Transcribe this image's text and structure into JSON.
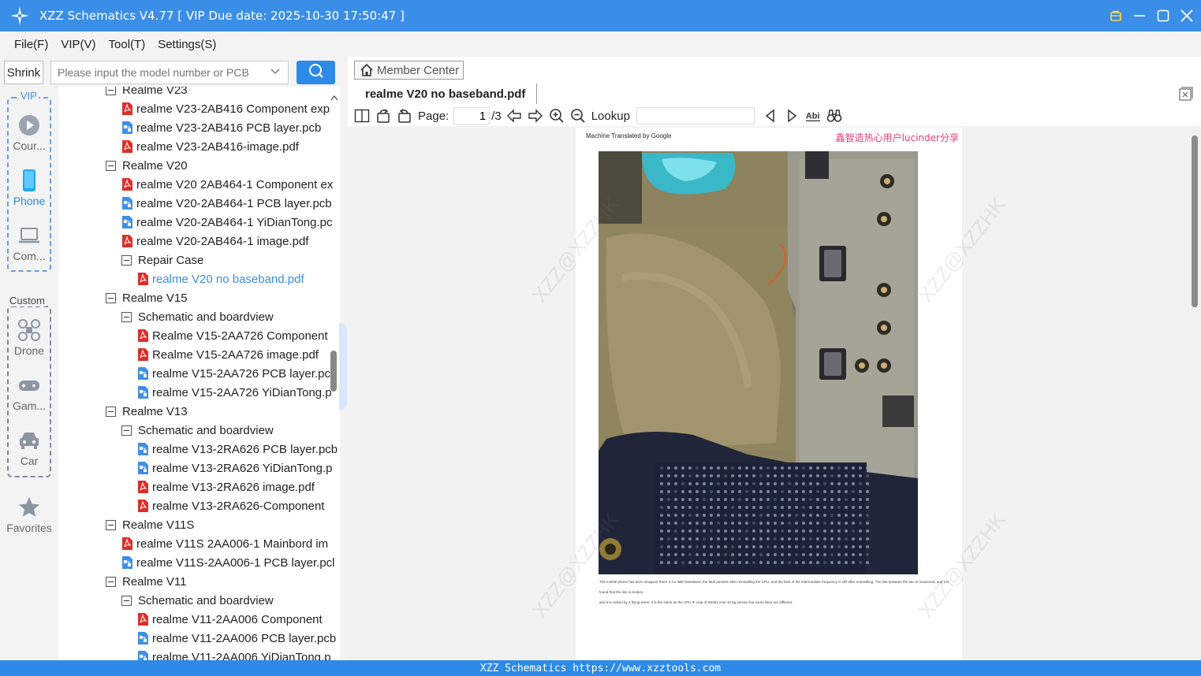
{
  "window": {
    "title": "XZZ Schematics V4.77 [ VIP Due date: 2025-10-30 17:50:47 ]",
    "icons": [
      "app-logo-icon",
      "bag-icon",
      "minimize-icon",
      "maximize-icon",
      "close-icon"
    ]
  },
  "menu": [
    "File(F)",
    "VIP(V)",
    "Tool(T)",
    "Settings(S)"
  ],
  "search": {
    "shrink_label": "Shrink",
    "placeholder": "Please input the model number or PCB"
  },
  "rail": {
    "vip_label": "VIP",
    "custom_label": "Custom",
    "items": [
      {
        "label": "Cour...",
        "icon": "play-circle-icon"
      },
      {
        "label": "Phone",
        "icon": "phone-icon"
      },
      {
        "label": "Com...",
        "icon": "laptop-icon"
      },
      {
        "label": "Drone",
        "icon": "drone-icon"
      },
      {
        "label": "Gam...",
        "icon": "gamepad-icon"
      },
      {
        "label": "Car",
        "icon": "car-icon"
      },
      {
        "label": "Favorites",
        "icon": "star-icon"
      }
    ]
  },
  "tree": [
    {
      "label": "Realme V23",
      "type": "folder"
    },
    {
      "label": "realme V23-2AB416 Component exp",
      "type": "pdf"
    },
    {
      "label": "realme V23-2AB416 PCB layer.pcb",
      "type": "pcb"
    },
    {
      "label": "realme V23-2AB416-image.pdf",
      "type": "pdf"
    },
    {
      "label": "Realme V20",
      "type": "folder"
    },
    {
      "label": "realme V20 2AB464-1 Component ex",
      "type": "pdf"
    },
    {
      "label": "realme V20-2AB464-1 PCB layer.pcb",
      "type": "pcb"
    },
    {
      "label": "realme V20-2AB464-1 YiDianTong.pc",
      "type": "pcb"
    },
    {
      "label": "realme V20-2AB464-1 image.pdf",
      "type": "pdf"
    },
    {
      "label": "Repair Case",
      "type": "folder"
    },
    {
      "label": "realme V20 no baseband.pdf",
      "type": "pdf"
    },
    {
      "label": "Realme V15",
      "type": "folder"
    },
    {
      "label": "Schematic and boardview",
      "type": "folder"
    },
    {
      "label": "Realme V15-2AA726 Component",
      "type": "pdf"
    },
    {
      "label": "Realme V15-2AA726 image.pdf",
      "type": "pdf"
    },
    {
      "label": "realme V15-2AA726 PCB layer.pcb",
      "type": "pcb"
    },
    {
      "label": "realme V15-2AA726 YiDianTong.p",
      "type": "pcb"
    },
    {
      "label": "Realme V13",
      "type": "folder"
    },
    {
      "label": "Schematic and boardview",
      "type": "folder"
    },
    {
      "label": "realme V13-2RA626 PCB layer.pcb",
      "type": "pcb"
    },
    {
      "label": "realme V13-2RA626 YiDianTong.p",
      "type": "pcb"
    },
    {
      "label": "realme V13-2RA626 image.pdf",
      "type": "pdf"
    },
    {
      "label": "realme V13-2RA626-Component",
      "type": "pdf"
    },
    {
      "label": "Realme V11S",
      "type": "folder"
    },
    {
      "label": "realme V11S 2AA006-1 Mainbord im",
      "type": "pdf"
    },
    {
      "label": "realme V11S-2AA006-1 PCB layer.pcl",
      "type": "pcb"
    },
    {
      "label": "Realme V11",
      "type": "folder"
    },
    {
      "label": "Schematic and boardview",
      "type": "folder"
    },
    {
      "label": "realme V11-2AA006 Component",
      "type": "pdf"
    },
    {
      "label": "realme V11-2AA006 PCB layer.pcb",
      "type": "pcb"
    },
    {
      "label": "realme V11-2AA006 YiDianTong.p",
      "type": "pcb"
    }
  ],
  "tree_selected_index": 10,
  "viewer": {
    "member_center": "Member Center",
    "tab_title": "realme V20 no baseband.pdf",
    "page_label": "Page:",
    "page_current": "1",
    "page_total": "/3",
    "lookup_label": "Lookup",
    "lookup_value": ""
  },
  "document": {
    "header_note": "Machine Translated by Google",
    "share_note": "鑫智造热心用户lucinder分享",
    "watermark": "XZZ@XZZHK",
    "caption_lines": [
      "The mobile phone has been dropped, there is no IMEI baseband, the fault persists after reinstalling the CPU, and the fault of the intermediate frequency is still after reinstalling. The line between the two is measured, and it is",
      "found that the line is broken,",
      "and it is solved by 2 flying wires. It is the same as the CPU IF chip of Redmi note 10 5g version but some lines are different."
    ]
  },
  "footer": "XZZ Schematics https://www.xzztools.com",
  "colors": {
    "accent": "#2d8ae6",
    "titlebar": "#3b8ee8",
    "pdf_icon": "#d9302c",
    "pcb_icon": "#3f8fe6",
    "selected_text": "#3b8ee8",
    "watermark_text": "#e0407a"
  }
}
